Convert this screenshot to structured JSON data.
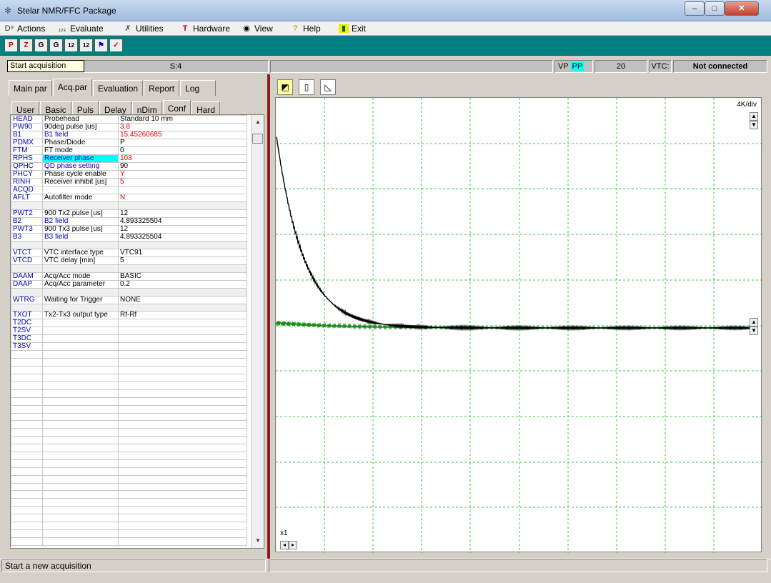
{
  "window": {
    "title": "Stelar NMR/FFC Package"
  },
  "menu": [
    {
      "icon": "actions-icon",
      "glyph": "D",
      "label": "Actions"
    },
    {
      "icon": "evaluate-icon",
      "glyph": "₁₂₃",
      "label": "Evaluate"
    },
    {
      "icon": "utilities-icon",
      "glyph": "✗",
      "label": "Utilities"
    },
    {
      "icon": "hardware-icon",
      "glyph": "T",
      "label": "Hardware"
    },
    {
      "icon": "view-icon",
      "glyph": "◉",
      "label": "View"
    },
    {
      "icon": "help-icon",
      "glyph": "?",
      "label": "Help"
    },
    {
      "icon": "exit-icon",
      "glyph": "▮",
      "label": "Exit"
    }
  ],
  "toolbar": {
    "buttons": [
      {
        "name": "start-acquisition-tool",
        "glyph": "P"
      },
      {
        "name": "zap-tool",
        "glyph": "Z"
      },
      {
        "name": "fit-tool",
        "glyph": "G"
      },
      {
        "name": "fit-tool-2",
        "glyph": "G"
      },
      {
        "name": "count-12-tool",
        "glyph": "12"
      },
      {
        "name": "count-12-cycle-tool",
        "glyph": "12"
      },
      {
        "name": "flag-tool",
        "glyph": "⚑"
      },
      {
        "name": "check-tool",
        "glyph": "✓"
      }
    ],
    "tooltip": "Start acquisition"
  },
  "status": {
    "scan": "S:4",
    "vp": "VP",
    "pp": "PP",
    "count": "20",
    "vtc_label": "VTC:",
    "vtc_state": "Not connected"
  },
  "tabs_main": [
    "Main par",
    "Acq.par",
    "Evaluation",
    "Report",
    "Log"
  ],
  "tabs_sub": [
    "User",
    "Basic",
    "Puls",
    "Delay",
    "nDim",
    "Conf",
    "Hard"
  ],
  "params": [
    {
      "code": "HEAD",
      "desc": "Probehead",
      "val": "Standard 10 mm"
    },
    {
      "code": "PW90",
      "desc": "90deg pulse [us]",
      "val": "3.8"
    },
    {
      "code": "B1",
      "desc": "B1 field",
      "val": "15.45260685"
    },
    {
      "code": "PDMX",
      "desc": "Phase/Diode",
      "val": "P"
    },
    {
      "code": "FTM",
      "desc": "FT mode",
      "val": "0"
    },
    {
      "code": "RPHS",
      "desc": "Receiver phase",
      "val": "103"
    },
    {
      "code": "QPHC",
      "desc": "QD phase setting",
      "val": "90"
    },
    {
      "code": "PHCY",
      "desc": "Phase cycle enable",
      "val": "Y"
    },
    {
      "code": "RINH",
      "desc": "Receiver inhibit [us]",
      "val": "5"
    },
    {
      "code": "ACQD",
      "desc": "",
      "val": ""
    },
    {
      "code": "AFLT",
      "desc": "Autofilter mode",
      "val": "N"
    },
    {
      "code": "",
      "desc": "",
      "val": ""
    },
    {
      "code": "PWT2",
      "desc": "900 Tx2 pulse [us]",
      "val": "12"
    },
    {
      "code": "B2",
      "desc": "B2 field",
      "val": "4.893325504"
    },
    {
      "code": "PWT3",
      "desc": "900 Tx3 pulse [us]",
      "val": "12"
    },
    {
      "code": "B3",
      "desc": "B3 field",
      "val": "4.893325504"
    },
    {
      "code": "",
      "desc": "",
      "val": ""
    },
    {
      "code": "VTCT",
      "desc": "VTC interface type",
      "val": "VTC91"
    },
    {
      "code": "VTCD",
      "desc": "VTC delay [min]",
      "val": "5"
    },
    {
      "code": "",
      "desc": "",
      "val": ""
    },
    {
      "code": "DAAM",
      "desc": "Acq/Acc mode",
      "val": "BASIC"
    },
    {
      "code": "DAAP",
      "desc": "Acq/Acc parameter",
      "val": "0.2"
    },
    {
      "code": "",
      "desc": "",
      "val": ""
    },
    {
      "code": "WTRG",
      "desc": "Waiting for Trigger",
      "val": "NONE"
    },
    {
      "code": "",
      "desc": "",
      "val": ""
    },
    {
      "code": "TXOT",
      "desc": "Tx2-Tx3 output type",
      "val": "Rf-Rf"
    },
    {
      "code": "T2DC",
      "desc": "",
      "val": ""
    },
    {
      "code": "T2SV",
      "desc": "",
      "val": ""
    },
    {
      "code": "T3DC",
      "desc": "",
      "val": ""
    },
    {
      "code": "T3SV",
      "desc": "",
      "val": ""
    }
  ],
  "plot": {
    "scale": "4K/div",
    "multiplier": "x1",
    "colors": {
      "real": "#000000",
      "imag": "#1a8a1a",
      "grid": "#2ecc40"
    }
  },
  "statusbar": {
    "message": "Start a new acquisition"
  }
}
